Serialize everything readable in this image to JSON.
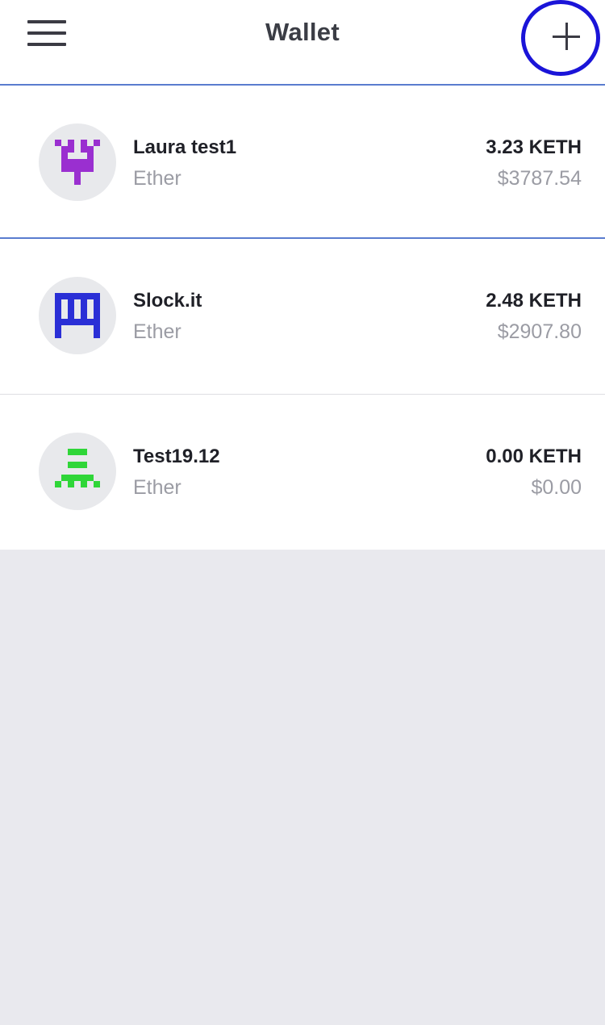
{
  "header": {
    "title": "Wallet",
    "menu_icon": "hamburger-menu-icon",
    "add_icon": "plus-icon",
    "highlight_color": "#1a14d8",
    "divider_color": "#5a7ccf"
  },
  "wallets": [
    {
      "name": "Laura test1",
      "currency": "Ether",
      "amount": "3.23 KETH",
      "fiat": "$3787.54",
      "identicon_color": "#9a2fd0",
      "icon": "identicon-purple"
    },
    {
      "name": "Slock.it",
      "currency": "Ether",
      "amount": "2.48 KETH",
      "fiat": "$2907.80",
      "identicon_color": "#2a2fd6",
      "icon": "identicon-blue"
    },
    {
      "name": "Test19.12",
      "currency": "Ether",
      "amount": "0.00 KETH",
      "fiat": "$0.00",
      "identicon_color": "#2fd638",
      "icon": "identicon-green"
    }
  ]
}
